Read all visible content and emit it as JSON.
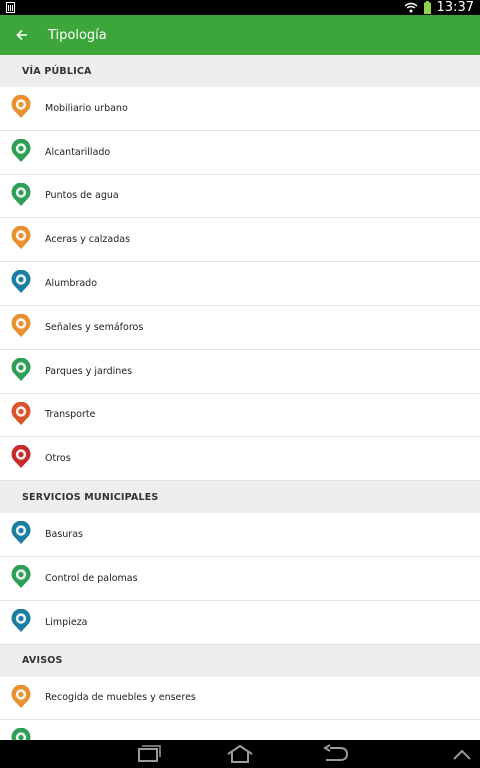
{
  "status_bar": {
    "time": "13:37"
  },
  "app_bar": {
    "title": "Tipología"
  },
  "sections": [
    {
      "header": "VÍA PÚBLICA",
      "items": [
        {
          "label": "Mobiliario urbano",
          "icon": "bench-icon",
          "color": "#e8912e"
        },
        {
          "label": "Alcantarillado",
          "icon": "sewer-icon",
          "color": "#2e9f55"
        },
        {
          "label": "Puntos de agua",
          "icon": "water-drop-icon",
          "color": "#2e9f55"
        },
        {
          "label": "Aceras y calzadas",
          "icon": "pedestrian-icon",
          "color": "#e8912e"
        },
        {
          "label": "Alumbrado",
          "icon": "lightbulb-icon",
          "color": "#1b7fa3"
        },
        {
          "label": "Señales y semáforos",
          "icon": "traffic-light-icon",
          "color": "#e8912e"
        },
        {
          "label": "Parques y jardines",
          "icon": "park-icon",
          "color": "#2e9f55"
        },
        {
          "label": "Transporte",
          "icon": "bus-icon",
          "color": "#d9532c"
        },
        {
          "label": "Otros",
          "icon": "warning-icon",
          "color": "#c62a2a"
        }
      ]
    },
    {
      "header": "SERVICIOS MUNICIPALES",
      "items": [
        {
          "label": "Basuras",
          "icon": "trash-icon",
          "color": "#1b7fa3"
        },
        {
          "label": "Control de palomas",
          "icon": "pigeon-icon",
          "color": "#2e9f55"
        },
        {
          "label": "Limpieza",
          "icon": "recycle-icon",
          "color": "#1b7fa3"
        }
      ]
    },
    {
      "header": "AVISOS",
      "items": [
        {
          "label": "Recogida de muebles y enseres",
          "icon": "truck-icon",
          "color": "#e8912e"
        },
        {
          "label": "",
          "icon": "partial-icon",
          "color": "#2e9f55"
        }
      ]
    }
  ]
}
